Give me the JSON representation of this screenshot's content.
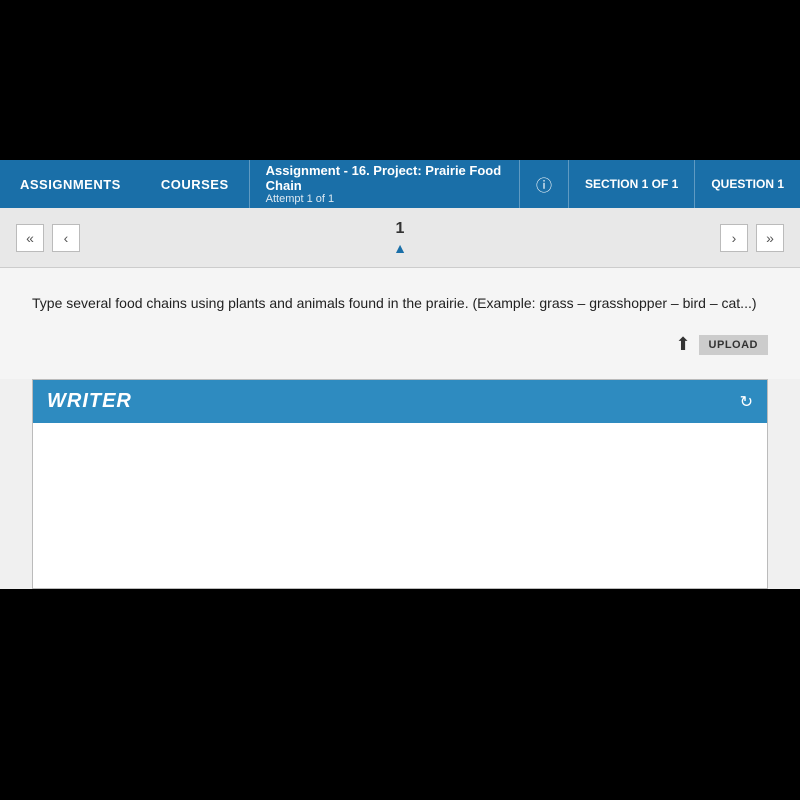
{
  "nav": {
    "assignments_label": "ASSIGNMENTS",
    "courses_label": "COURSES",
    "assignment_prefix": "Assignment",
    "assignment_title": "- 16. Project: Prairie Food Chain",
    "attempt_label": "Attempt 1 of 1",
    "section_label": "SECTION 1 OF 1",
    "question_label": "QUESTION 1"
  },
  "pagination": {
    "double_left_label": "«",
    "left_label": "‹",
    "page_number": "1",
    "double_right_label": "»",
    "right_label": "›"
  },
  "question": {
    "text": "Type several food chains using plants and animals found in the prairie. (Example: grass – grasshopper – bird – cat...)"
  },
  "upload": {
    "button_label": "UPLOAD"
  },
  "writer": {
    "title": "WRITER",
    "placeholder": ""
  }
}
